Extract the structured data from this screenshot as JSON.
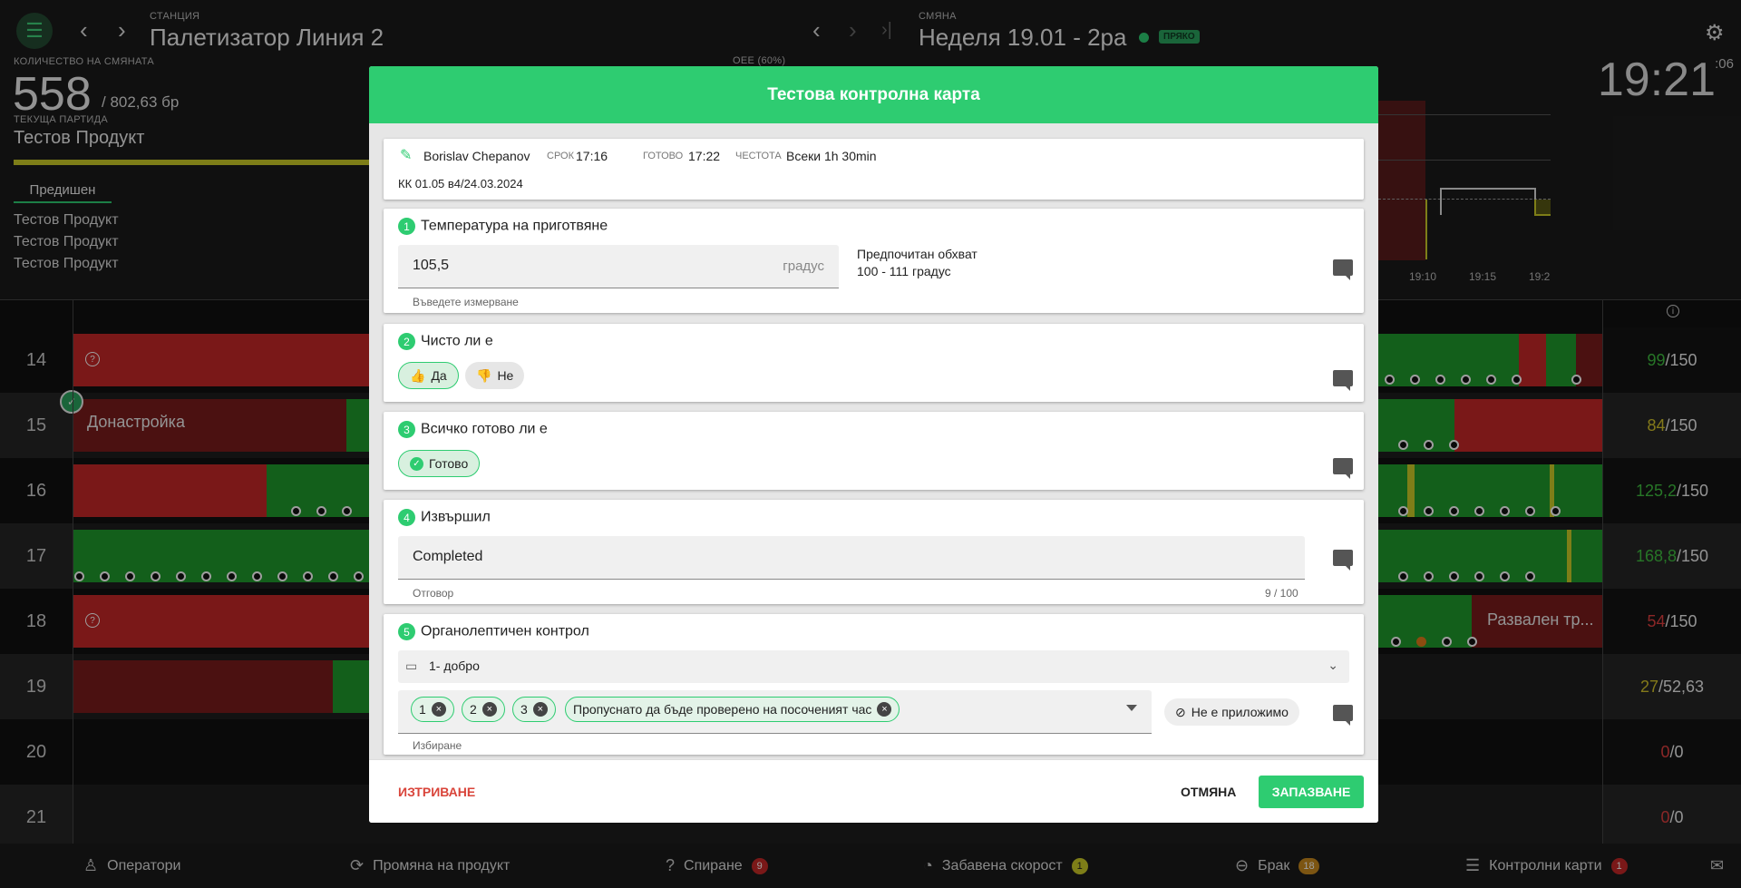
{
  "header": {
    "station_label": "СТАНЦИЯ",
    "station_name": "Палетизатор Линия 2",
    "shift_label": "СМЯНА",
    "shift_name": "Неделя 19.01 - 2ра",
    "shift_status": "ПРЯКО",
    "clock": "19:21",
    "clock_seconds": ":06",
    "quantity_label": "КОЛИЧЕСТВО НА СМЯНАТА",
    "quantity_value": "558",
    "quantity_total": "/ 802,63 бр",
    "batch_label": "ТЕКУЩА ПАРТИДА",
    "batch_value": "Тестов Продукт",
    "oee_label": "OEE (60%)",
    "previous_tab": "Предишен",
    "previous_items": [
      "Тестов Продукт",
      "Тестов Продукт",
      "Тестов Продукт"
    ],
    "chart_ticks": [
      "19:10",
      "19:15",
      "19:2"
    ]
  },
  "rows": [
    {
      "hour": "14",
      "done": "99",
      "total": "/150",
      "done_color": "#3fbf3f"
    },
    {
      "hour": "15",
      "done": "84",
      "total": "/150",
      "done_color": "#d4c42a",
      "label": "Донастройка"
    },
    {
      "hour": "16",
      "done": "125,2",
      "total": "/150",
      "done_color": "#3fbf3f"
    },
    {
      "hour": "17",
      "done": "168,8",
      "total": "/150",
      "done_color": "#3fbf3f"
    },
    {
      "hour": "18",
      "done": "54",
      "total": "/150",
      "done_color": "#e04040",
      "label": "Развален тр..."
    },
    {
      "hour": "19",
      "done": "27",
      "total": "/52,63",
      "done_color": "#d4c42a"
    },
    {
      "hour": "20",
      "done": "0",
      "total": "/0",
      "done_color": "#e04040"
    },
    {
      "hour": "21",
      "done": "0",
      "total": "/0",
      "done_color": "#e04040"
    }
  ],
  "bottom": {
    "operators": "Оператори",
    "change_product": "Промяна на продукт",
    "stops": "Спиране",
    "stops_count": "9",
    "slow_speed": "Забавена скорост",
    "slow_count": "1",
    "scrap": "Брак",
    "scrap_count": "18",
    "control_cards": "Контролни карти",
    "cards_count": "1"
  },
  "modal": {
    "title": "Тестова контролна карта",
    "author": "Borislav Chepanov",
    "deadline_label": "СРОК",
    "deadline": "17:16",
    "done_label": "ГОТОВО",
    "done": "17:22",
    "freq_label": "ЧЕСТОТА",
    "freq": "Всеки 1h 30min",
    "doc": "КК 01.05 в4/24.03.2024",
    "q1": {
      "num": "1",
      "title": "Температура на приготвяне",
      "value": "105,5",
      "unit": "градус",
      "hint": "Въведете измерване",
      "range_label": "Предпочитан обхват",
      "range": "100 - 111 градус"
    },
    "q2": {
      "num": "2",
      "title": "Чисто ли е",
      "yes": "Да",
      "no": "Не"
    },
    "q3": {
      "num": "3",
      "title": "Всичко готово ли е",
      "ready": "Готово"
    },
    "q4": {
      "num": "4",
      "title": "Извършил",
      "value": "Completed",
      "hint": "Отговор",
      "counter": "9 / 100"
    },
    "q5": {
      "num": "5",
      "title": "Органолептичен контрол",
      "select": "1- добро",
      "tags": [
        "1",
        "2",
        "3",
        "Пропуснато да бъде проверено на посоченият час"
      ],
      "hint": "Избиране",
      "na": "Не е приложимо"
    },
    "delete": "ИЗТРИВАНЕ",
    "cancel": "ОТМЯНА",
    "save": "ЗАПАЗВАНЕ"
  }
}
